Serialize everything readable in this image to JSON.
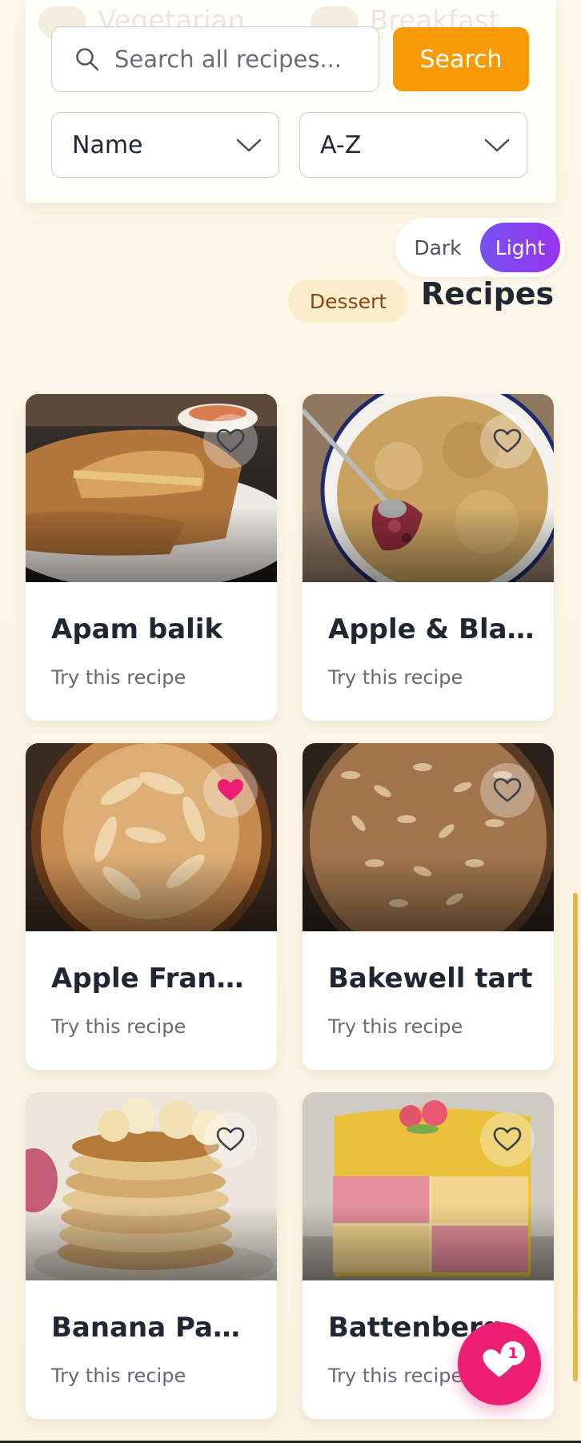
{
  "search": {
    "placeholder": "Search all recipes...",
    "button_label": "Search",
    "sort_field": "Name",
    "sort_order": "A-Z"
  },
  "background_rows": [
    "Vegetarian",
    "Breakfast"
  ],
  "theme": {
    "dark_label": "Dark",
    "light_label": "Light",
    "active": "Light",
    "accent_from": "#7652ef",
    "accent_to": "#9a34ee"
  },
  "heading": {
    "category": "Dessert",
    "title": "Recipes"
  },
  "recipes": [
    {
      "title": "Apam balik",
      "subtitle": "Try this recipe",
      "favorite": false,
      "icon": "heart-outline-icon"
    },
    {
      "title": "Apple & Blackberry Crumble",
      "subtitle": "Try this recipe",
      "favorite": false,
      "icon": "heart-outline-icon"
    },
    {
      "title": "Apple Frangipan Tart",
      "subtitle": "Try this recipe",
      "favorite": true,
      "icon": "heart-filled-icon"
    },
    {
      "title": "Bakewell tart",
      "subtitle": "Try this recipe",
      "favorite": false,
      "icon": "heart-outline-icon"
    },
    {
      "title": "Banana Pancakes",
      "subtitle": "Try this recipe",
      "favorite": false,
      "icon": "heart-outline-icon"
    },
    {
      "title": "Battenberg Cake",
      "subtitle": "Try this recipe",
      "favorite": false,
      "icon": "heart-outline-icon"
    }
  ],
  "favorites": {
    "count": "1",
    "icon": "heart-filled-icon"
  },
  "colors": {
    "primary_button": "#f79a06",
    "favorite": "#ec1f74",
    "badge_bg": "#fdeecb",
    "badge_text": "#8b4513"
  }
}
